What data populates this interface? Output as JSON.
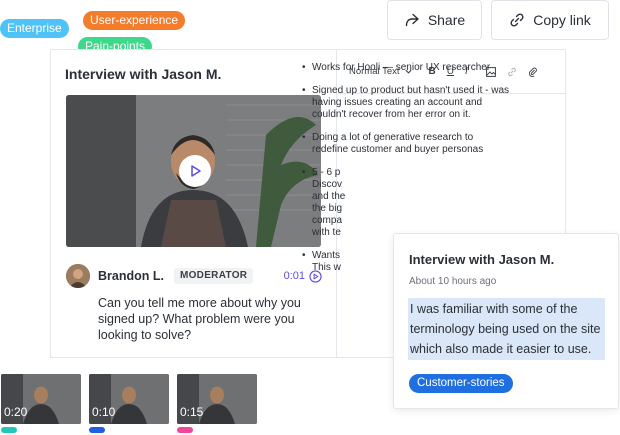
{
  "tags": {
    "enterprise": "Enterprise",
    "user_experience": "User-experience",
    "pain_points": "Pain-points"
  },
  "actions": {
    "share_label": "Share",
    "copy_link_label": "Copy link"
  },
  "interview": {
    "title": "Interview with Jason M.",
    "speaker_name": "Brandon L.",
    "speaker_role": "MODERATOR",
    "timestamp": "0:01",
    "question": "Can you tell me more about why you signed up? What problem were you looking to solve?"
  },
  "editor": {
    "format_label": "Normal Text",
    "bold": "B",
    "underline": "U",
    "italic": "I",
    "notes": [
      "Works for Hooli — senior UX researcher",
      "Signed up to product but hasn't used it - was having issues creating an account and couldn't recover from her error on it.",
      "Doing a lot of generative research to redefine customer and buyer personas",
      "5 - 6 p",
      "Discov",
      "and the",
      "the big",
      "compa",
      "with te",
      "Wants",
      "This w"
    ]
  },
  "highlight": {
    "title": "Interview with Jason M.",
    "time": "About 10 hours ago",
    "quote": "I was familiar with some of the terminology being used on the site which also made it easier to use.",
    "tag": "Customer-stories"
  },
  "clips": [
    {
      "time": "0:20",
      "color": "#22c7b8"
    },
    {
      "time": "0:10",
      "color": "#1f5fe0"
    },
    {
      "time": "0:15",
      "color": "#f0479a"
    }
  ],
  "colors": {
    "accent": "#5b4de0",
    "highlight_bg": "#d9e7f9",
    "story_tag": "#1f6fe0"
  }
}
